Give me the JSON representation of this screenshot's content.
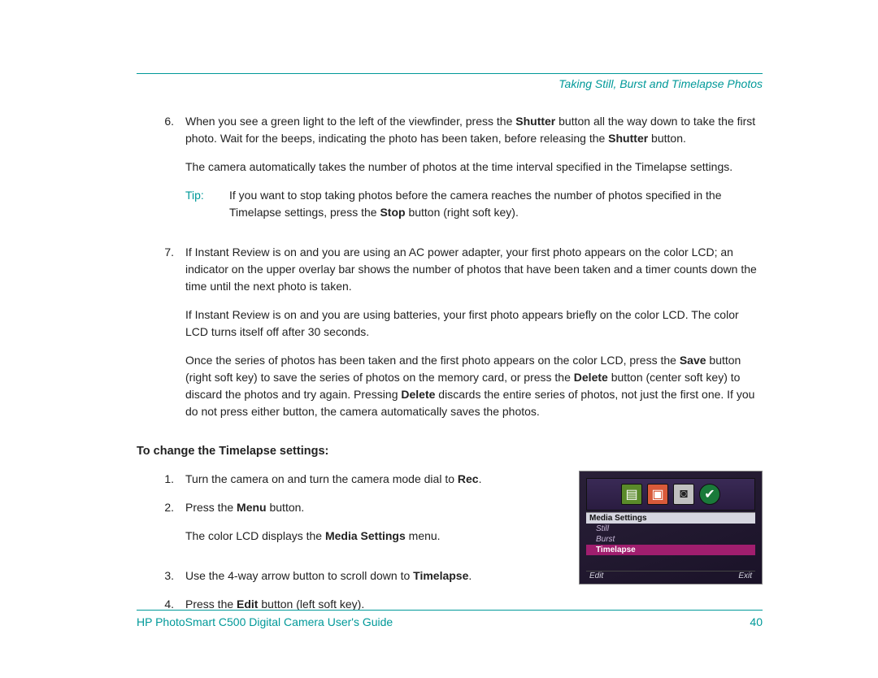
{
  "header": {
    "chapter": "Taking Still, Burst and Timelapse Photos"
  },
  "step6": {
    "num": "6.",
    "p1a": "When you see a green light to the left of the viewfinder, press the ",
    "p1b": "Shutter",
    "p1c": " button all the way down to take the first photo. Wait for the beeps, indicating the photo has been taken, before releasing the ",
    "p1d": "Shutter",
    "p1e": " button.",
    "p2": "The camera automatically takes the number of photos at the time interval specified in the Timelapse settings.",
    "tip_label": "Tip:",
    "tip_a": "If you want to stop taking photos before the camera reaches the number of photos specified in the Timelapse settings, press the ",
    "tip_b": "Stop",
    "tip_c": " button (right soft key)."
  },
  "step7": {
    "num": "7.",
    "p1": "If Instant Review is on and you are using an AC power adapter, your first photo appears on the color LCD; an indicator on the upper overlay bar shows the number of photos that have been taken and a timer counts down the time until the next photo is taken.",
    "p2": "If Instant Review is on and you are using batteries, your first photo appears briefly on the color LCD. The color LCD turns itself off after 30 seconds.",
    "p3a": "Once the series of photos has been taken and the first photo appears on the color LCD, press the ",
    "p3b": "Save",
    "p3c": " button (right soft key) to save the series of photos on the memory card, or press the ",
    "p3d": "Delete",
    "p3e": " button (center soft key) to discard the photos and try again. Pressing ",
    "p3f": "Delete",
    "p3g": " discards the entire series of photos, not just the first one. If you do not press either button, the camera automatically saves the photos."
  },
  "section2": {
    "title": "To change the Timelapse settings:",
    "s1": {
      "num": "1.",
      "a": "Turn the camera on and turn the camera mode dial to ",
      "b": "Rec",
      "c": "."
    },
    "s2": {
      "num": "2.",
      "a": "Press the ",
      "b": "Menu",
      "c": " button.",
      "p2a": "The color LCD displays the ",
      "p2b": "Media Settings",
      "p2c": " menu."
    },
    "s3": {
      "num": "3.",
      "a": "Use the 4-way arrow button to scroll down to ",
      "b": "Timelapse",
      "c": "."
    },
    "s4": {
      "num": "4.",
      "a": "Press the ",
      "b": "Edit",
      "c": " button (left soft key)."
    }
  },
  "lcd": {
    "title": "Media Settings",
    "items": [
      "Still",
      "Burst",
      "Timelapse"
    ],
    "selected": 2,
    "left": "Edit",
    "right": "Exit"
  },
  "footer": {
    "title": "HP PhotoSmart C500 Digital Camera User's Guide",
    "page": "40"
  }
}
